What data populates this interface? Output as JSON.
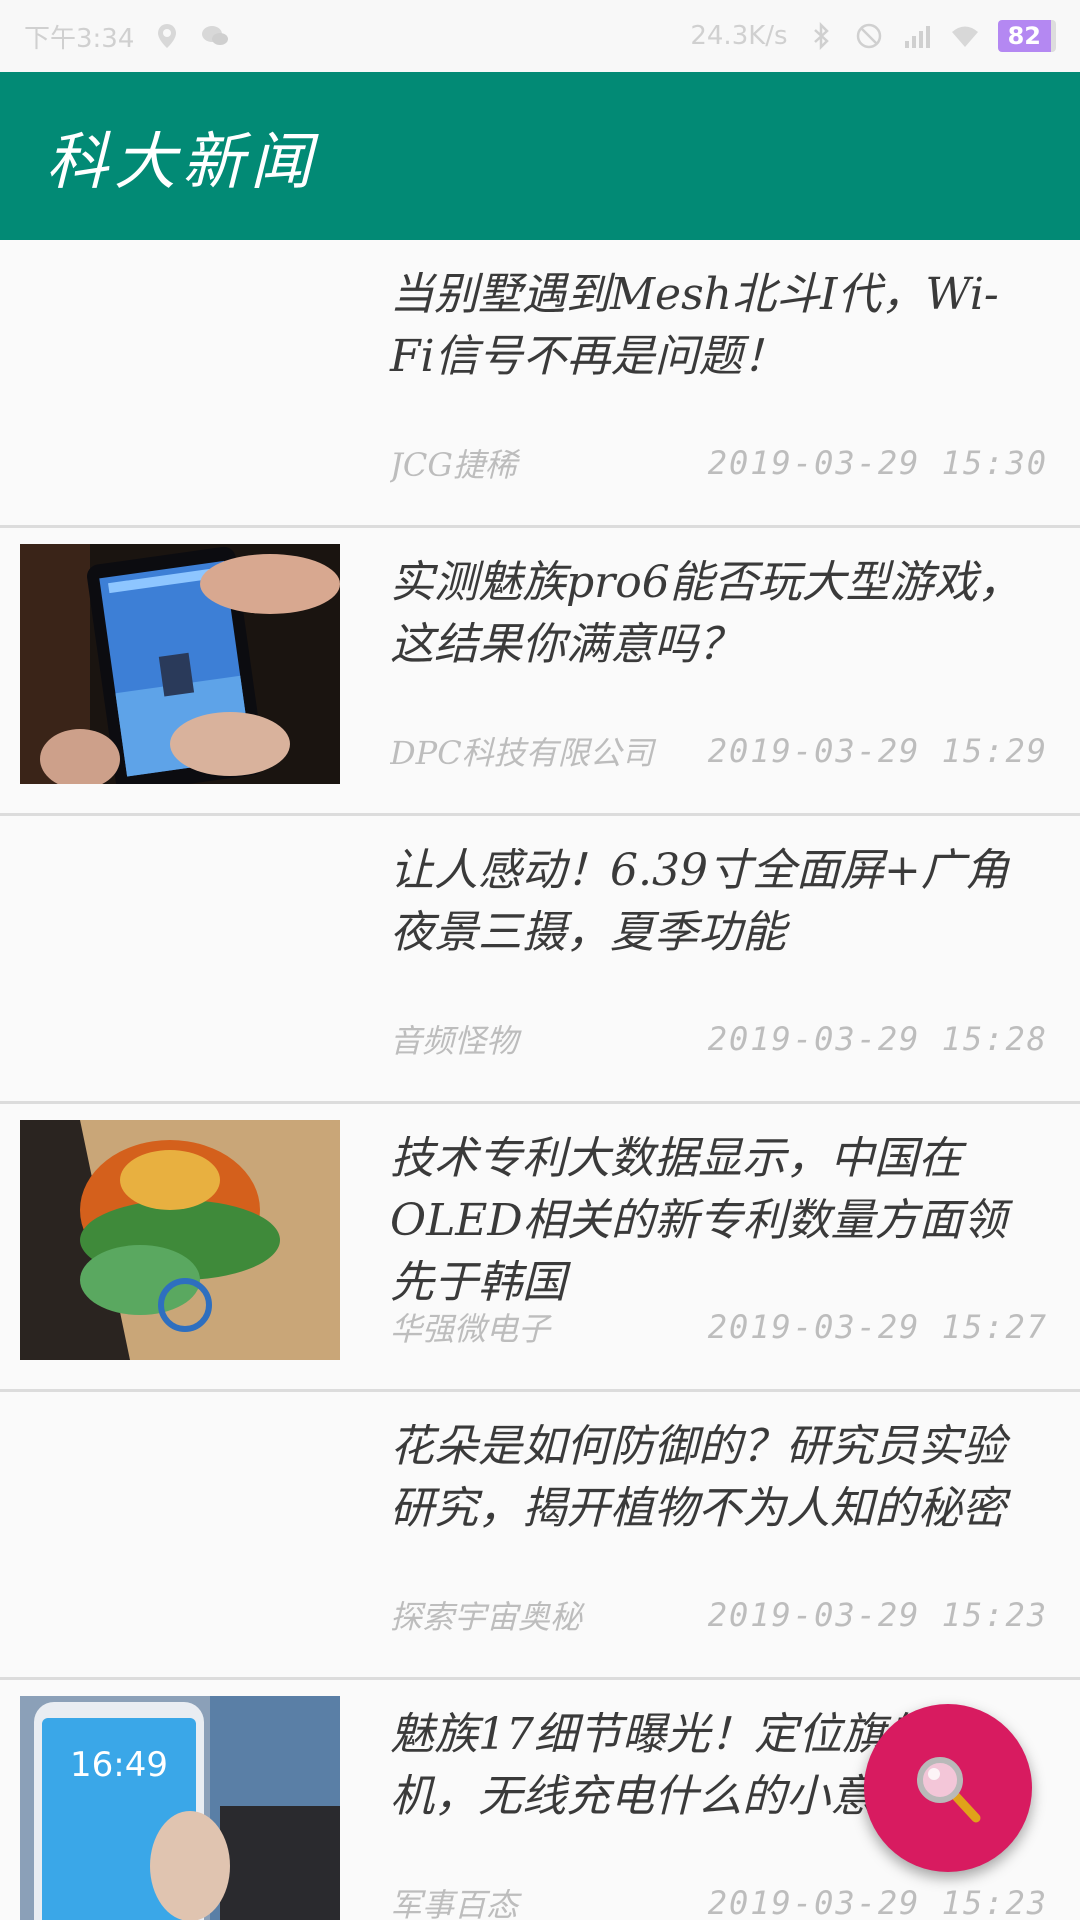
{
  "status_bar": {
    "time": "下午3:34",
    "network_speed": "24.3K/s",
    "battery": "82"
  },
  "app_bar": {
    "title": "科大新闻"
  },
  "news": [
    {
      "title": "当别墅遇到Mesh北斗I代，Wi-Fi信号不再是问题！",
      "source": "JCG捷稀",
      "time": "2019-03-29 15:30",
      "has_image": false
    },
    {
      "title": "实测魅族pro6能否玩大型游戏，这结果你满意吗？",
      "source": "DPC科技有限公司",
      "time": "2019-03-29 15:29",
      "has_image": true
    },
    {
      "title": "让人感动！6.39寸全面屏+广角夜景三摄，夏季功能",
      "source": "音频怪物",
      "time": "2019-03-29 15:28",
      "has_image": false
    },
    {
      "title": "技术专利大数据显示，中国在OLED相关的新专利数量方面领先于韩国",
      "source": "华强微电子",
      "time": "2019-03-29 15:27",
      "has_image": true
    },
    {
      "title": "花朵是如何防御的？研究员实验研究，揭开植物不为人知的秘密",
      "source": "探索宇宙奥秘",
      "time": "2019-03-29 15:23",
      "has_image": false
    },
    {
      "title": "魅族17细节曝光！定位旗舰手机，无线充电什么的小意思！",
      "source": "军事百态",
      "time": "2019-03-29 15:23",
      "has_image": true
    }
  ],
  "fab": {
    "icon": "magnifier-icon"
  },
  "colors": {
    "app_bar": "#028a75",
    "fab": "#d81b60",
    "divider": "#dcdcdc"
  }
}
